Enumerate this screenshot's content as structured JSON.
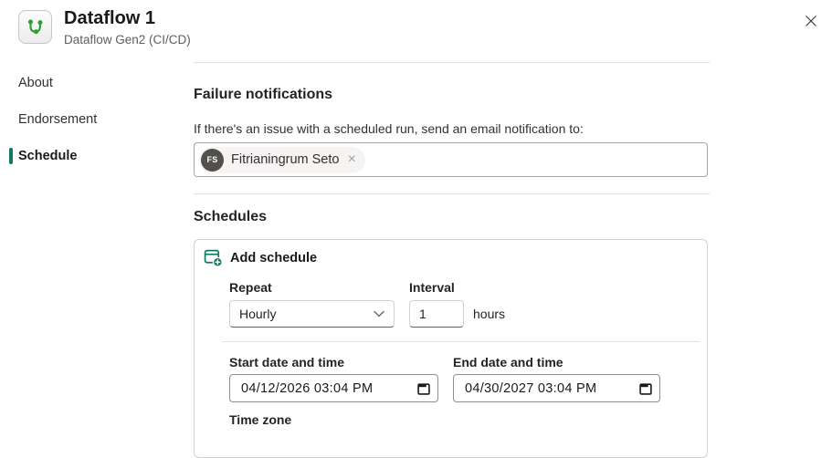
{
  "header": {
    "title": "Dataflow 1",
    "subtitle": "Dataflow Gen2 (CI/CD)"
  },
  "colors": {
    "accent_teal": "#117865",
    "dataflow_green": "#2f9e2f",
    "avatar_bg": "#51504e"
  },
  "icons": {
    "dataflow_icon": "dataflow-branch",
    "close_icon": "close-x",
    "add_schedule_icon": "calendar-add",
    "chevron_down_icon": "chevron-down",
    "calendar_icon": "calendar",
    "remove_icon": "×"
  },
  "sidebar": {
    "items": [
      {
        "label": "About"
      },
      {
        "label": "Endorsement"
      },
      {
        "label": "Schedule"
      }
    ],
    "active_index": 2
  },
  "failure_notifications": {
    "heading": "Failure notifications",
    "description": "If there's an issue with a scheduled run, send an email notification to:",
    "recipient": {
      "initials": "FS",
      "name": "Fitrianingrum Seto",
      "remove_label": "×"
    }
  },
  "schedules": {
    "heading": "Schedules",
    "add_schedule_label": "Add schedule",
    "repeat": {
      "label": "Repeat",
      "value": "Hourly"
    },
    "interval": {
      "label": "Interval",
      "value": "1",
      "unit": "hours"
    },
    "start": {
      "label": "Start date and time",
      "value": "04/12/2026 03:04 PM"
    },
    "end": {
      "label": "End date and time",
      "value": "04/30/2027 03:04 PM"
    },
    "time_zone": {
      "label": "Time zone"
    }
  }
}
